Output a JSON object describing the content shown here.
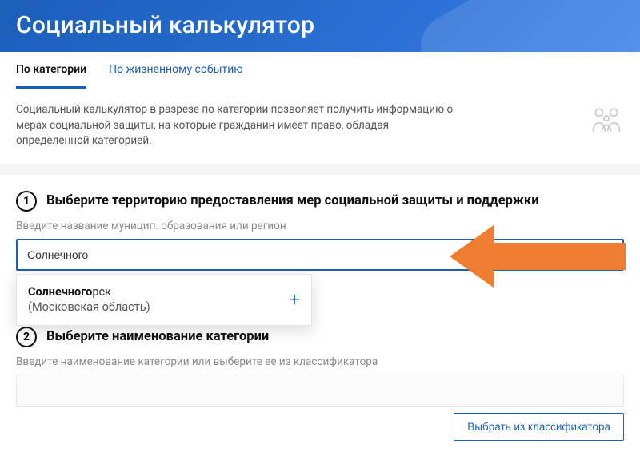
{
  "header": {
    "title": "Социальный калькулятор"
  },
  "tabs": [
    {
      "label": "По категории",
      "active": true
    },
    {
      "label": "По жизненному событию",
      "active": false
    }
  ],
  "intro": {
    "text": "Социальный калькулятор в разрезе по категории позволяет получить информацию о мерах социальной защиты, на которые гражданин имеет право, обладая определенной категорией."
  },
  "step1": {
    "num": "1",
    "title": "Выберите территорию предоставления мер социальной защиты и поддержки",
    "label": "Введите название муницип. образования или регион",
    "value": "Солнечного",
    "suggestion": {
      "match": "Солнечного",
      "rest": "рск",
      "region": "(Московская область)"
    }
  },
  "step2": {
    "num": "2",
    "title": "Выберите наименование категории",
    "label": "Введите наименование категории или выберите ее из классификатора",
    "button": "Выбрать из классификатора"
  }
}
